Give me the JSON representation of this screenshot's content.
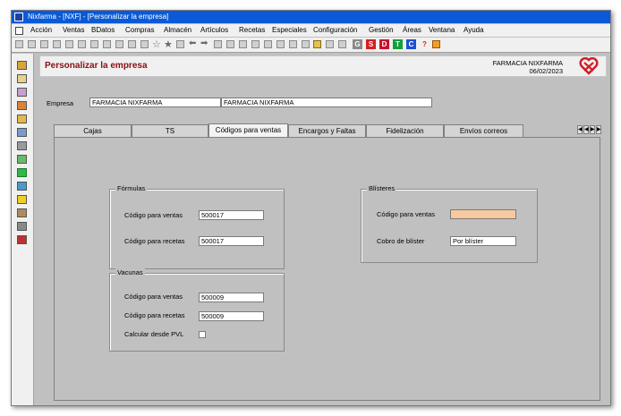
{
  "window": {
    "title": "Nixfarma - [NXF] - [Personalizar la empresa]"
  },
  "menu": [
    "Acción",
    "Ventas",
    "BDatos",
    "Compras",
    "Almacén",
    "Artículos",
    "Recetas",
    "Especiales",
    "Configuración",
    "Gestión",
    "Áreas",
    "Ventana",
    "Ayuda"
  ],
  "toolbar": {
    "letters": [
      "G",
      "S",
      "D",
      "T",
      "C",
      "?"
    ],
    "letter_colors": [
      "#8a8a8a",
      "#d41f1f",
      "#c8102e",
      "#14a03a",
      "#1f4fd1",
      "#e02020"
    ]
  },
  "header": {
    "page_title": "Personalizar la empresa",
    "company_name": "FARMACIA NIXFARMA",
    "date": "06/02/2023"
  },
  "empresa": {
    "label": "Empresa",
    "code": "FARMACIA NIXFARMA",
    "name": "FARMACIA NIXFARMA"
  },
  "tabs": [
    "Cajas",
    "TS",
    "Códigos para ventas",
    "Encargos y Faltas",
    "Fidelización",
    "Envíos correos"
  ],
  "active_tab": "Códigos para ventas",
  "formulas": {
    "title": "Fórmulas",
    "ventas_label": "Código para ventas",
    "ventas_value": "500017",
    "recetas_label": "Código para recetas",
    "recetas_value": "500017"
  },
  "vacunas": {
    "title": "Vacunas",
    "ventas_label": "Código para ventas",
    "ventas_value": "500009",
    "recetas_label": "Código para recetas",
    "recetas_value": "500009",
    "pvl_label": "Calcular desde PVL",
    "pvl_checked": false
  },
  "blisteres": {
    "title": "Blísteres",
    "ventas_label": "Código para ventas",
    "ventas_value": "",
    "cobro_label": "Cobro de blíster",
    "cobro_value": "Por blíster"
  },
  "colors": {
    "titlebar": "#0a5ad8",
    "page_title": "#8b0d12",
    "highlight_field": "#f8c9a0",
    "logo": "#d11f2a"
  }
}
